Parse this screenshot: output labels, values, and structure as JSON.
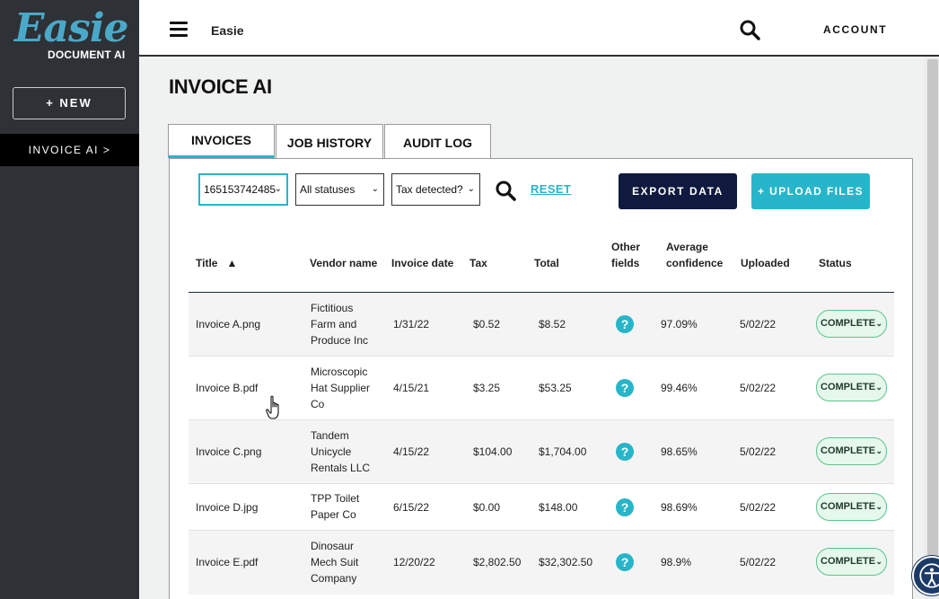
{
  "brand": {
    "logo_word": "Easie",
    "logo_sub": "DOCUMENT AI"
  },
  "sidebar": {
    "new_label": "+ NEW",
    "active_item": "INVOICE AI >"
  },
  "topbar": {
    "app_name": "Easie",
    "account_label": "ACCOUNT"
  },
  "page": {
    "title": "INVOICE AI"
  },
  "tabs": [
    {
      "label": "INVOICES",
      "active": true
    },
    {
      "label": "JOB HISTORY",
      "active": false
    },
    {
      "label": "AUDIT LOG",
      "active": false
    }
  ],
  "filters": {
    "job": "165153742485",
    "status": "All statuses",
    "tax": "Tax detected?",
    "reset_label": "RESET"
  },
  "actions": {
    "export_label": "EXPORT DATA",
    "upload_label": "+ UPLOAD FILES"
  },
  "table": {
    "columns": {
      "title": "Title",
      "sort_indicator": "▲",
      "vendor": "Vendor name",
      "date": "Invoice date",
      "tax": "Tax",
      "total": "Total",
      "other_1": "Other",
      "other_2": "fields",
      "conf_1": "Average",
      "conf_2": "confidence",
      "uploaded": "Uploaded",
      "status": "Status"
    },
    "rows": [
      {
        "title": "Invoice A.png",
        "vendor": [
          "Fictitious",
          "Farm and",
          "Produce Inc"
        ],
        "date": "1/31/22",
        "tax": "$0.52",
        "total": "$8.52",
        "other": "?",
        "confidence": "97.09%",
        "uploaded": "5/02/22",
        "status": "COMPLETE"
      },
      {
        "title": "Invoice B.pdf",
        "vendor": [
          "Microscopic",
          "Hat Supplier",
          "Co"
        ],
        "date": "4/15/21",
        "tax": "$3.25",
        "total": "$53.25",
        "other": "?",
        "confidence": "99.46%",
        "uploaded": "5/02/22",
        "status": "COMPLETE"
      },
      {
        "title": "Invoice C.png",
        "vendor": [
          "Tandem",
          "Unicycle",
          "Rentals LLC"
        ],
        "date": "4/15/22",
        "tax": "$104.00",
        "total": "$1,704.00",
        "other": "?",
        "confidence": "98.65%",
        "uploaded": "5/02/22",
        "status": "COMPLETE"
      },
      {
        "title": "Invoice D.jpg",
        "vendor": [
          "TPP Toilet",
          "Paper Co"
        ],
        "date": "6/15/22",
        "tax": "$0.00",
        "total": "$148.00",
        "other": "?",
        "confidence": "98.69%",
        "uploaded": "5/02/22",
        "status": "COMPLETE"
      },
      {
        "title": "Invoice E.pdf",
        "vendor": [
          "Dinosaur",
          "Mech Suit",
          "Company"
        ],
        "date": "12/20/22",
        "tax": "$2,802.50",
        "total": "$32,302.50",
        "other": "?",
        "confidence": "98.9%",
        "uploaded": "5/02/22",
        "status": "COMPLETE"
      }
    ]
  },
  "colors": {
    "sidebar": "#2e3135",
    "accent": "#27b5c9",
    "navy": "#0f1a3e",
    "status_bg": "#e6f7ec",
    "status_border": "#5ac48c"
  },
  "icons": [
    "hamburger-icon",
    "search-icon",
    "chevron-down-icon",
    "question-icon",
    "hand-cursor-icon",
    "accessibility-icon"
  ]
}
